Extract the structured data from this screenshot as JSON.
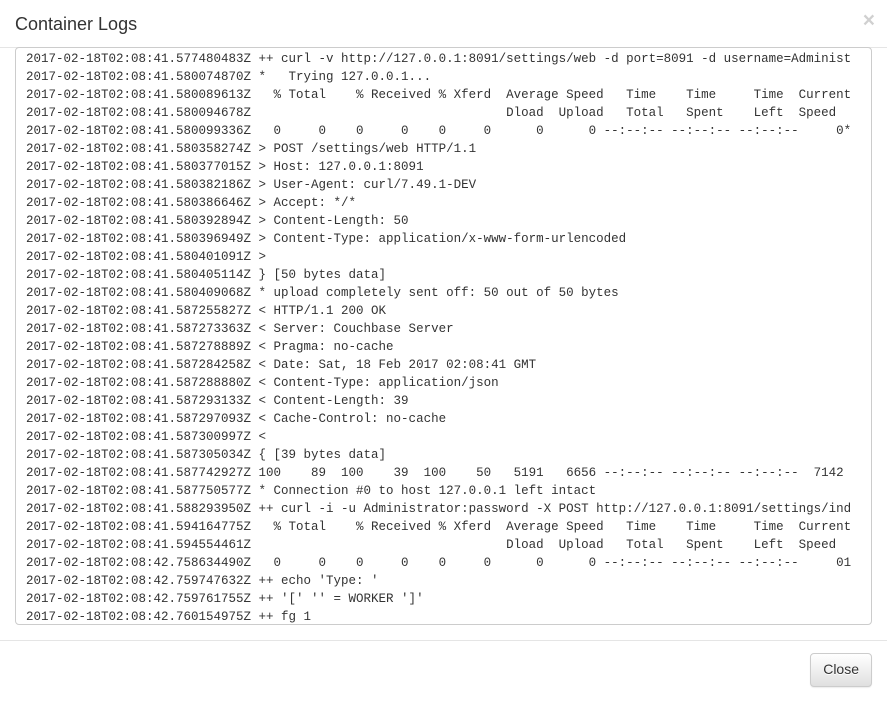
{
  "header": {
    "title": "Container Logs"
  },
  "logs": [
    "2017-02-18T02:08:41.577480483Z ++ curl -v http://127.0.0.1:8091/settings/web -d port=8091 -d username=Administ",
    "2017-02-18T02:08:41.580074870Z *   Trying 127.0.0.1...",
    "2017-02-18T02:08:41.580089613Z   % Total    % Received % Xferd  Average Speed   Time    Time     Time  Current",
    "2017-02-18T02:08:41.580094678Z                                  Dload  Upload   Total   Spent    Left  Speed",
    "2017-02-18T02:08:41.580099336Z   0     0    0     0    0     0      0      0 --:--:-- --:--:-- --:--:--     0*",
    "2017-02-18T02:08:41.580358274Z > POST /settings/web HTTP/1.1",
    "2017-02-18T02:08:41.580377015Z > Host: 127.0.0.1:8091",
    "2017-02-18T02:08:41.580382186Z > User-Agent: curl/7.49.1-DEV",
    "2017-02-18T02:08:41.580386646Z > Accept: */*",
    "2017-02-18T02:08:41.580392894Z > Content-Length: 50",
    "2017-02-18T02:08:41.580396949Z > Content-Type: application/x-www-form-urlencoded",
    "2017-02-18T02:08:41.580401091Z > ",
    "2017-02-18T02:08:41.580405114Z } [50 bytes data]",
    "2017-02-18T02:08:41.580409068Z * upload completely sent off: 50 out of 50 bytes",
    "2017-02-18T02:08:41.587255827Z < HTTP/1.1 200 OK",
    "2017-02-18T02:08:41.587273363Z < Server: Couchbase Server",
    "2017-02-18T02:08:41.587278889Z < Pragma: no-cache",
    "2017-02-18T02:08:41.587284258Z < Date: Sat, 18 Feb 2017 02:08:41 GMT",
    "2017-02-18T02:08:41.587288880Z < Content-Type: application/json",
    "2017-02-18T02:08:41.587293133Z < Content-Length: 39",
    "2017-02-18T02:08:41.587297093Z < Cache-Control: no-cache",
    "2017-02-18T02:08:41.587300997Z < ",
    "2017-02-18T02:08:41.587305034Z { [39 bytes data]",
    "2017-02-18T02:08:41.587742927Z 100    89  100    39  100    50   5191   6656 --:--:-- --:--:-- --:--:--  7142",
    "2017-02-18T02:08:41.587750577Z * Connection #0 to host 127.0.0.1 left intact",
    "2017-02-18T02:08:41.588293950Z ++ curl -i -u Administrator:password -X POST http://127.0.0.1:8091/settings/ind",
    "2017-02-18T02:08:41.594164775Z   % Total    % Received % Xferd  Average Speed   Time    Time     Time  Current",
    "2017-02-18T02:08:41.594554461Z                                  Dload  Upload   Total   Spent    Left  Speed",
    "2017-02-18T02:08:42.758634490Z   0     0    0     0    0     0      0      0 --:--:-- --:--:-- --:--:--     01",
    "2017-02-18T02:08:42.759747632Z ++ echo 'Type: '",
    "2017-02-18T02:08:42.759761755Z ++ '[' '' = WORKER ']'",
    "2017-02-18T02:08:42.760154975Z ++ fg 1"
  ],
  "footer": {
    "close_label": "Close"
  }
}
